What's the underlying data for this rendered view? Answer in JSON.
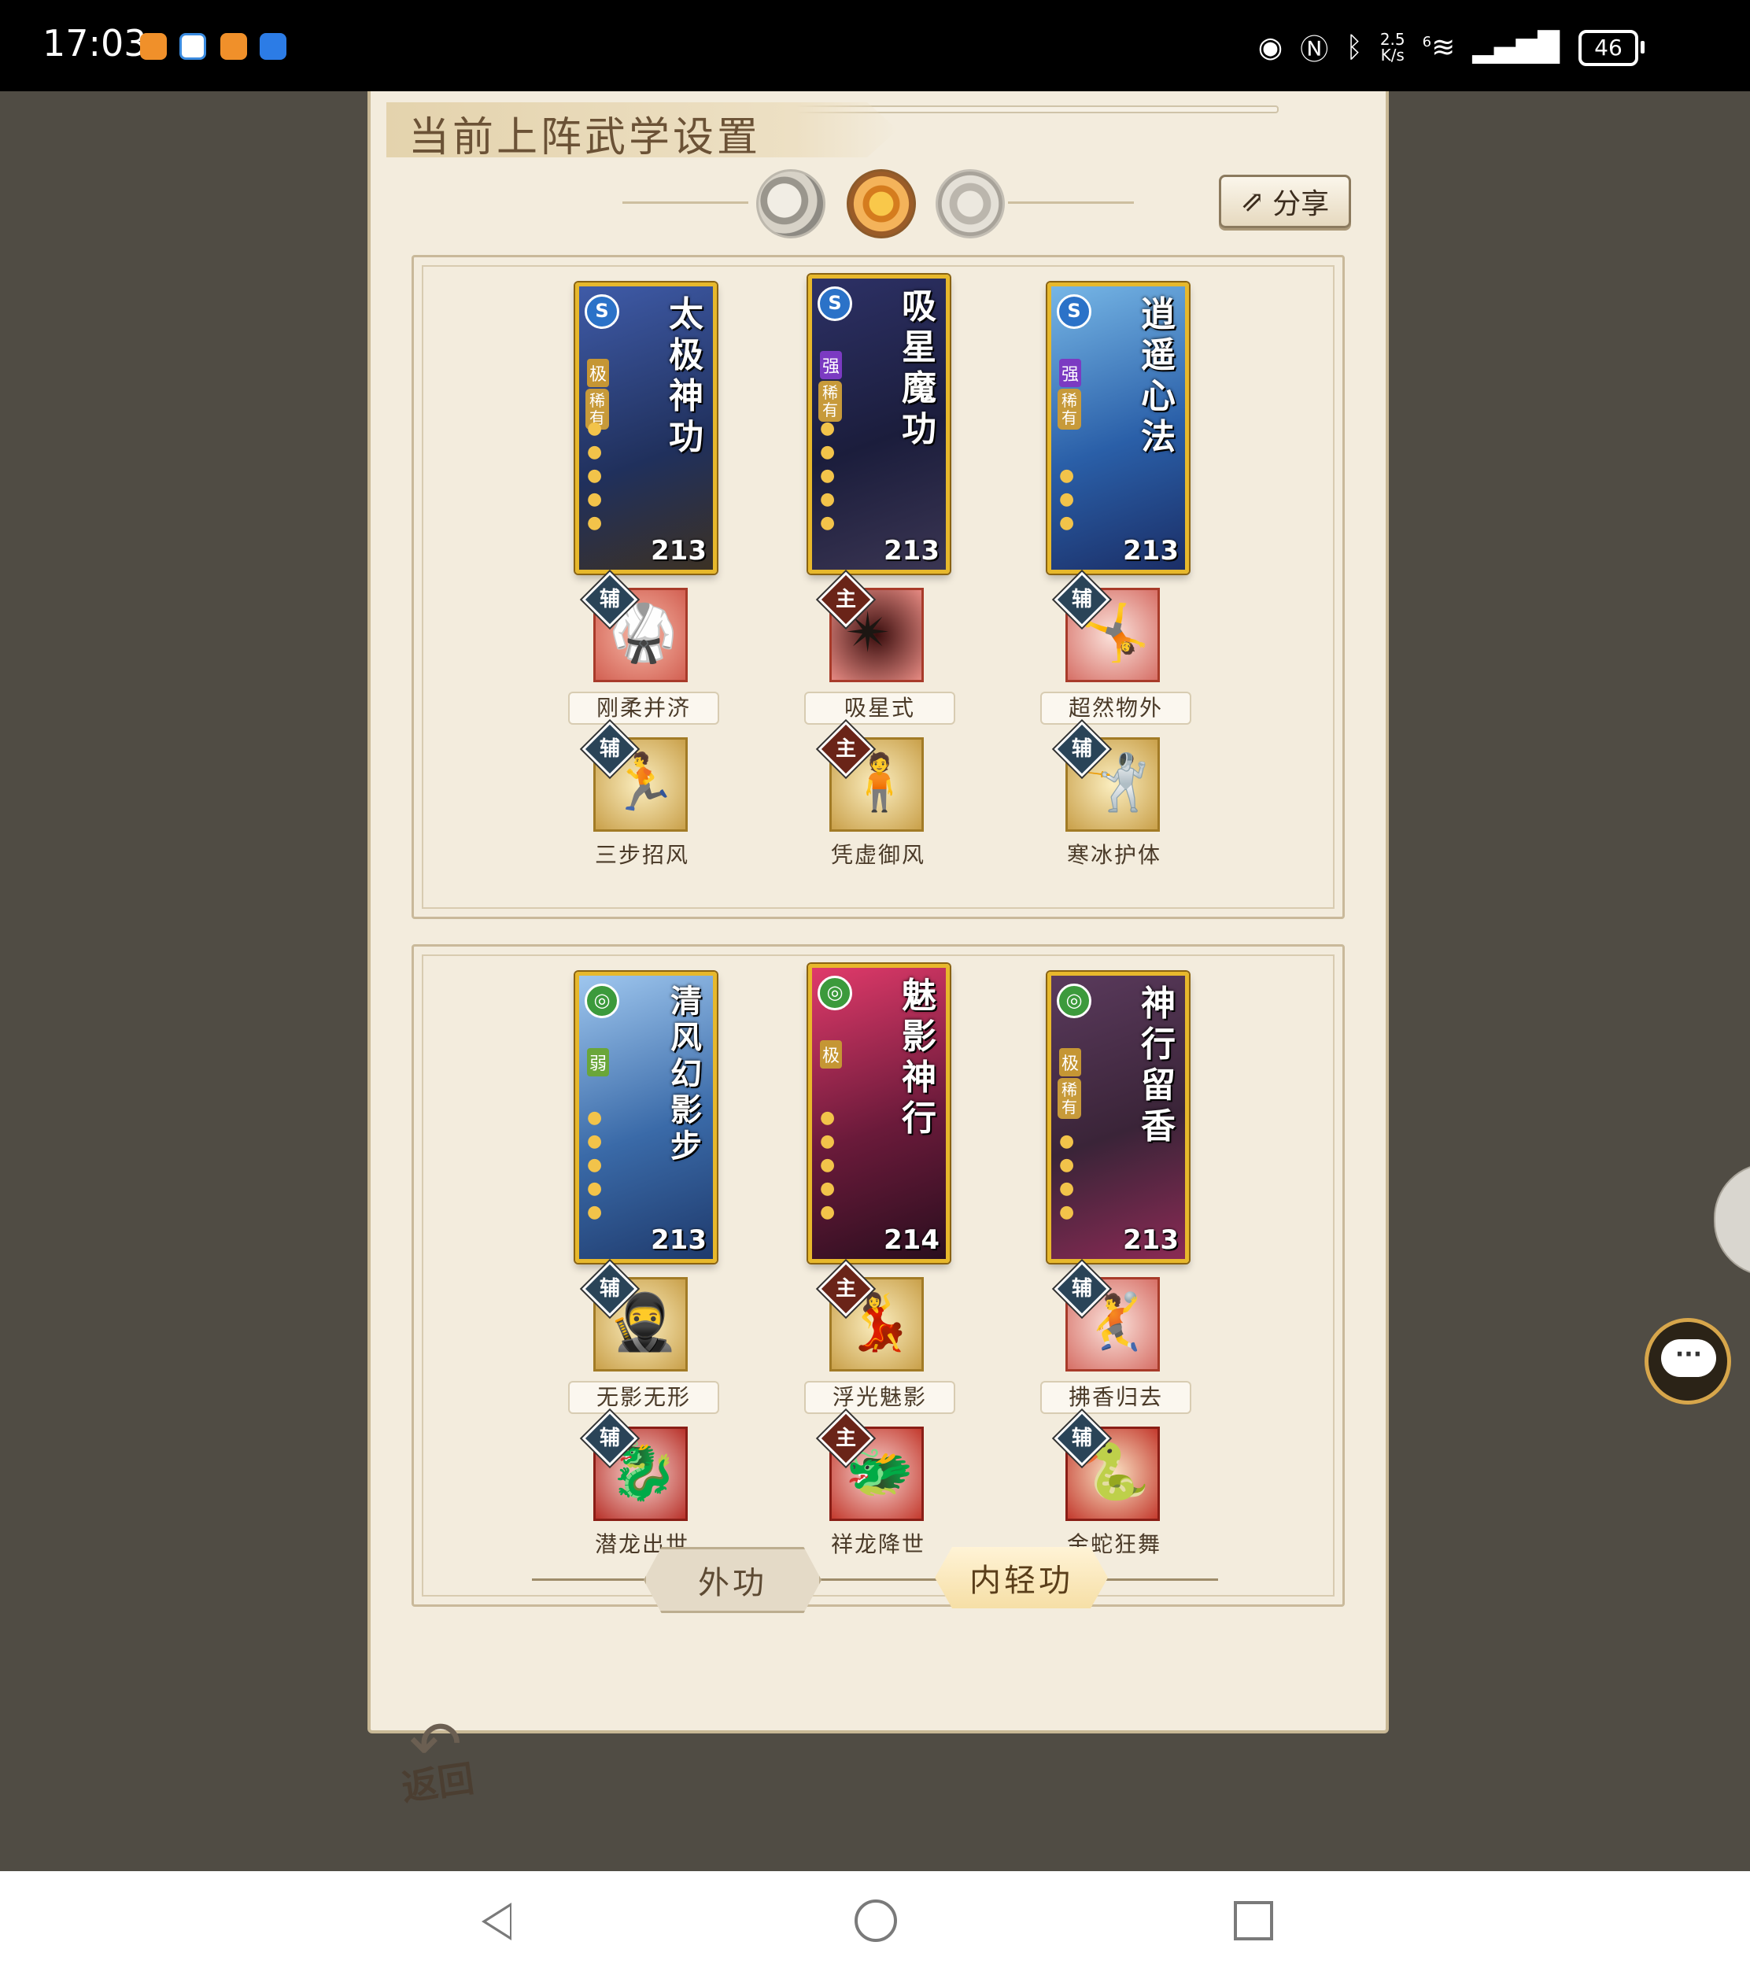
{
  "status_bar": {
    "time": "17:03",
    "net_speed_value": "2.5",
    "net_speed_unit": "K/s",
    "network": "6",
    "battery": "46",
    "icons": [
      "eye-icon",
      "nfc-icon",
      "bluetooth-icon",
      "wifi-icon",
      "signal-icon"
    ]
  },
  "panel": {
    "title": "当前上阵武学设置",
    "share_label": "分享",
    "mode_icons": [
      "moon-icon",
      "sun-icon",
      "star-icon"
    ],
    "selected_mode": "sun-icon"
  },
  "sections": [
    {
      "columns": [
        {
          "card": {
            "name": "太极神功",
            "school": "S",
            "tier": "极",
            "rare": "稀有",
            "level": "213",
            "color": "#2a3e7c"
          },
          "skill1": {
            "role": "辅",
            "label": "刚柔并济",
            "role_color": "#2a4458"
          },
          "skill2": {
            "role": "辅",
            "label": "三步招风",
            "role_color": "#2a4458"
          }
        },
        {
          "card": {
            "name": "吸星魔功",
            "school": "S",
            "tier": "强",
            "rare": "稀有",
            "level": "213",
            "color": "#2a2a54"
          },
          "skill1": {
            "role": "主",
            "label": "吸星式",
            "role_color": "#6a2418"
          },
          "skill2": {
            "role": "主",
            "label": "凭虚御风",
            "role_color": "#6a2418"
          }
        },
        {
          "card": {
            "name": "逍遥心法",
            "school": "S",
            "tier": "强",
            "rare": "稀有",
            "level": "213",
            "color": "#1f4f8c"
          },
          "skill1": {
            "role": "辅",
            "label": "超然物外",
            "role_color": "#2a4458"
          },
          "skill2": {
            "role": "辅",
            "label": "寒冰护体",
            "role_color": "#2a4458"
          }
        }
      ]
    },
    {
      "columns": [
        {
          "card": {
            "name": "清风幻影步",
            "school": "◎",
            "tier": "弱",
            "rare": "",
            "level": "213",
            "color": "#3a6aa8"
          },
          "skill1": {
            "role": "辅",
            "label": "无影无形",
            "role_color": "#2a4458"
          },
          "skill2": {
            "role": "辅",
            "label": "潜龙出世",
            "role_color": "#2a4458"
          }
        },
        {
          "card": {
            "name": "魅影神行",
            "school": "◎",
            "tier": "极",
            "rare": "",
            "level": "214",
            "color": "#6a1a3a"
          },
          "skill1": {
            "role": "主",
            "label": "浮光魅影",
            "role_color": "#6a2418"
          },
          "skill2": {
            "role": "主",
            "label": "祥龙降世",
            "role_color": "#6a2418"
          }
        },
        {
          "card": {
            "name": "神行留香",
            "school": "◎",
            "tier": "极",
            "rare": "稀有",
            "level": "213",
            "color": "#3a2438"
          },
          "skill1": {
            "role": "辅",
            "label": "拂香归去",
            "role_color": "#2a4458"
          },
          "skill2": {
            "role": "辅",
            "label": "金蛇狂舞",
            "role_color": "#2a4458"
          }
        }
      ]
    }
  ],
  "tabs": {
    "outer": "外功",
    "inner": "内轻功",
    "selected": "inner"
  },
  "back_label": "返回"
}
